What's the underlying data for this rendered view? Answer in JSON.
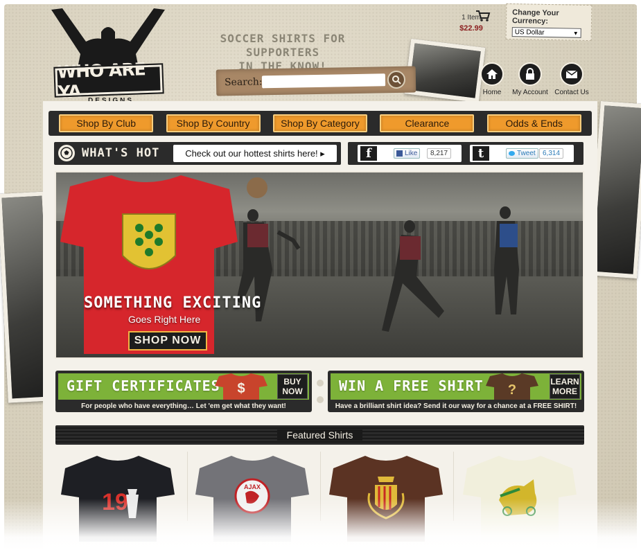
{
  "brand": {
    "logo_text": "WHO ARE YA",
    "logo_sub": "DESIGNS",
    "tagline_line1": "SOCCER SHIRTS FOR SUPPORTERS",
    "tagline_line2": "IN THE KNOW!"
  },
  "search": {
    "label": "Search:",
    "placeholder": ""
  },
  "cart": {
    "count": "1 Item",
    "total": "$22.99",
    "icon": "cart-icon"
  },
  "currency": {
    "label": "Change Your Currency:",
    "selected": "US Dollar"
  },
  "header_links": [
    {
      "label": "Home",
      "icon": "home-icon"
    },
    {
      "label": "My Account",
      "icon": "lock-icon"
    },
    {
      "label": "Contact Us",
      "icon": "envelope-icon"
    }
  ],
  "nav": {
    "items": [
      {
        "label": "Shop By Club"
      },
      {
        "label": "Shop By Country"
      },
      {
        "label": "Shop By Category"
      },
      {
        "label": "Clearance"
      },
      {
        "label": "Odds & Ends"
      }
    ]
  },
  "whats_hot": {
    "title": "WHAT'S HOT",
    "link": "Check out our hottest shirts here! ▸"
  },
  "social": {
    "facebook": {
      "letter": "f",
      "button": "Like",
      "count": "8,217"
    },
    "twitter": {
      "letter": "t",
      "button": "Tweet",
      "count": "6,314"
    }
  },
  "hero": {
    "headline": "SOMETHING EXCITING",
    "sub": "Goes Right Here",
    "button": "SHOP NOW"
  },
  "promos": [
    {
      "title": "GIFT CERTIFICATES",
      "cta_line1": "BUY",
      "cta_line2": "NOW",
      "desc": "For people who have everything… Let 'em get what they want!",
      "shirt_symbol": "$"
    },
    {
      "title": "WIN A FREE SHIRT",
      "cta_line1": "LEARN",
      "cta_line2": "MORE",
      "desc": "Have a brilliant shirt idea? Send it our way for a chance at a FREE SHIRT!",
      "shirt_symbol": "?"
    }
  ],
  "featured": {
    "title": "Featured Shirts",
    "shirts": [
      {
        "color": "#1e1f24",
        "print": "19"
      },
      {
        "color": "#737378",
        "print": "AJAX"
      },
      {
        "color": "#5b3323",
        "print": ""
      },
      {
        "color": "#f1efdc",
        "print": ""
      }
    ]
  },
  "colors": {
    "accent_orange": "#ef9a2c",
    "promo_green": "#7db239",
    "dark": "#2b2b2b",
    "cart_red": "#8b1e1e"
  }
}
